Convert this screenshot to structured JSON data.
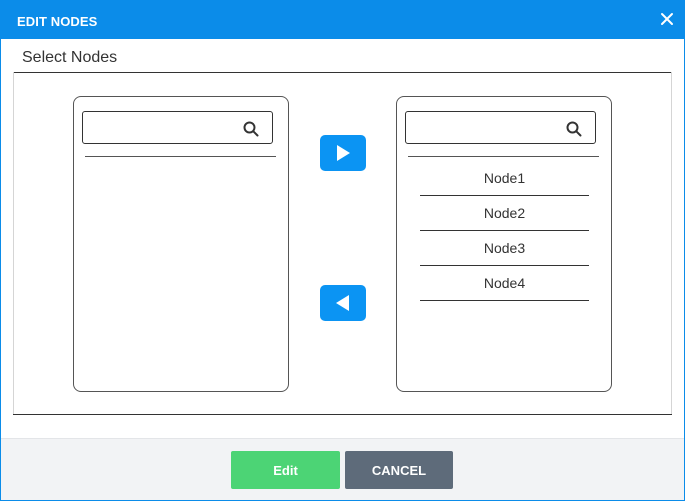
{
  "dialog": {
    "title": "EDIT NODES",
    "close_icon": "close-icon"
  },
  "section": {
    "title": "Select Nodes"
  },
  "available_panel": {
    "search_placeholder": "",
    "search_value": "",
    "search_icon": "search-icon",
    "items": []
  },
  "selected_panel": {
    "search_placeholder": "",
    "search_value": "",
    "search_icon": "search-icon",
    "items": [
      "Node1",
      "Node2",
      "Node3",
      "Node4"
    ]
  },
  "transfer": {
    "add_icon": "play-right-icon",
    "remove_icon": "play-left-icon"
  },
  "footer": {
    "edit_label": "Edit",
    "cancel_label": "CANCEL"
  },
  "colors": {
    "header": "#0b8ce9",
    "arrow_button": "#0b94f3",
    "edit_button": "#4cd475",
    "cancel_button": "#5e6b7a",
    "footer_bg": "#f2f3f5"
  }
}
